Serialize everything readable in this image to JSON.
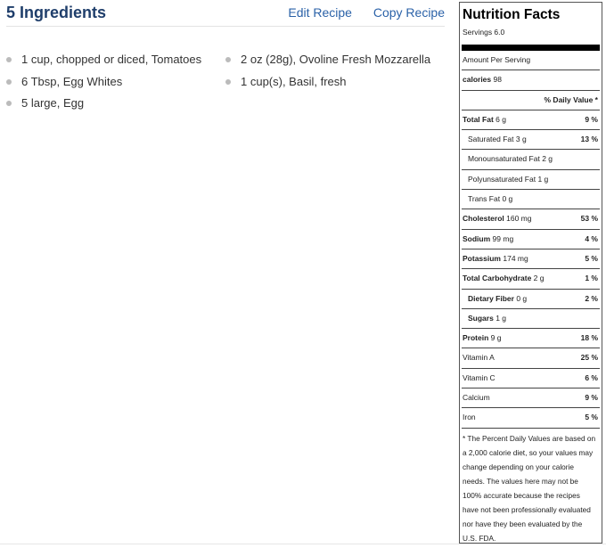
{
  "ingredients": {
    "title": "5 Ingredients",
    "edit_label": "Edit Recipe",
    "copy_label": "Copy Recipe",
    "column1": [
      "1 cup, chopped or diced, Tomatoes",
      "6 Tbsp, Egg Whites",
      "5 large, Egg"
    ],
    "column2": [
      "2 oz (28g), Ovoline Fresh Mozzarella",
      "1 cup(s), Basil, fresh"
    ]
  },
  "nutrition": {
    "title": "Nutrition Facts",
    "servings": "Servings 6.0",
    "amount_per_serving": "Amount Per Serving",
    "calories_label": "calories",
    "calories_value": "98",
    "daily_value_header": "% Daily Value *",
    "rows": [
      {
        "label": "Total Fat",
        "amount": "6 g",
        "pct": "9 %"
      },
      {
        "label": "Saturated Fat",
        "amount": "3 g",
        "pct": "13 %"
      },
      {
        "label": "Monounsaturated Fat",
        "amount": "2 g",
        "pct": ""
      },
      {
        "label": "Polyunsaturated Fat",
        "amount": "1 g",
        "pct": ""
      },
      {
        "label": "Trans Fat",
        "amount": "0 g",
        "pct": ""
      },
      {
        "label": "Cholesterol",
        "amount": "160 mg",
        "pct": "53 %"
      },
      {
        "label": "Sodium",
        "amount": "99 mg",
        "pct": "4 %"
      },
      {
        "label": "Potassium",
        "amount": "174 mg",
        "pct": "5 %"
      },
      {
        "label": "Total Carbohydrate",
        "amount": "2 g",
        "pct": "1 %"
      },
      {
        "label": "Dietary Fiber",
        "amount": "0 g",
        "pct": "2 %"
      },
      {
        "label": "Sugars",
        "amount": "1 g",
        "pct": ""
      },
      {
        "label": "Protein",
        "amount": "9 g",
        "pct": "18 %"
      },
      {
        "label": "Vitamin A",
        "amount": "",
        "pct": "25 %"
      },
      {
        "label": "Vitamin C",
        "amount": "",
        "pct": "6 %"
      },
      {
        "label": "Calcium",
        "amount": "",
        "pct": "9 %"
      },
      {
        "label": "Iron",
        "amount": "",
        "pct": "5 %"
      }
    ],
    "footnote": "* The Percent Daily Values are based on a 2,000 calorie diet, so your values may change depending on your calorie needs. The values here may not be 100% accurate because the recipes have not been professionally evaluated nor have they been evaluated by the U.S. FDA."
  }
}
